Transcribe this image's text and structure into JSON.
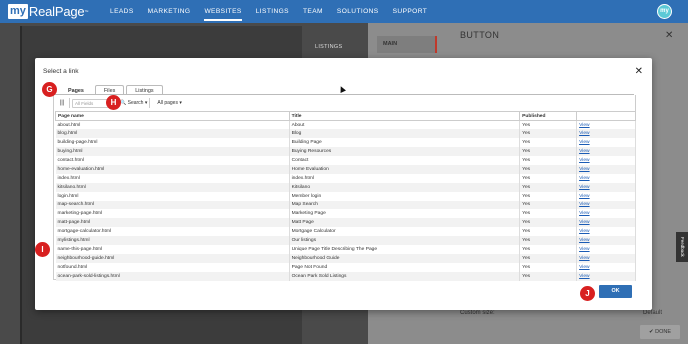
{
  "logo": {
    "my": "my",
    "brand": "RealPage",
    "tm": "™"
  },
  "nav": [
    "LEADS",
    "MARKETING",
    "WEBSITES",
    "LISTINGS",
    "TEAM",
    "SOLUTIONS",
    "SUPPORT"
  ],
  "nav_active": "WEBSITES",
  "user": {
    "initials": "my"
  },
  "background": {
    "listings_label": "LISTINGS",
    "main_tab": "MAIN",
    "panel_title": "BUTTON",
    "close": "✕",
    "feedback": "Feedback",
    "custom_size_label": "Custom size:",
    "custom_size_value": "Default",
    "done_label": "✔ DONE"
  },
  "modal": {
    "title": "Select a link",
    "close": "✕",
    "tabs": [
      "Pages",
      "Files",
      "Listings"
    ],
    "active_tab": "Pages",
    "toolbar": {
      "columns_icon": "|||",
      "filter_placeholder": "All Fields",
      "search_label": "Search ▾",
      "scope_label": "All pages ▾"
    },
    "table": {
      "headers": [
        "Page name",
        "Title",
        "Published",
        ""
      ],
      "rows": [
        [
          "about.html",
          "About",
          "Yes",
          "View"
        ],
        [
          "blog.html",
          "Blog",
          "Yes",
          "View"
        ],
        [
          "building-page.html",
          "Building Page",
          "Yes",
          "View"
        ],
        [
          "buying.html",
          "Buying Resources",
          "Yes",
          "View"
        ],
        [
          "contact.html",
          "Contact",
          "Yes",
          "View"
        ],
        [
          "home-evaluation.html",
          "Home Evaluation",
          "Yes",
          "View"
        ],
        [
          "index.html",
          "index.html",
          "Yes",
          "View"
        ],
        [
          "kitsilano.html",
          "Kitsilano",
          "Yes",
          "View"
        ],
        [
          "login.html",
          "Member login",
          "Yes",
          "View"
        ],
        [
          "map-search.html",
          "Map Search",
          "Yes",
          "View"
        ],
        [
          "marketing-page.html",
          "Marketing Page",
          "Yes",
          "View"
        ],
        [
          "matt-page.html",
          "Matt Page",
          "Yes",
          "View"
        ],
        [
          "mortgage-calculator.html",
          "Mortgage Calculator",
          "Yes",
          "View"
        ],
        [
          "mylistings.html",
          "Our listings",
          "Yes",
          "View"
        ],
        [
          "name-this-page.html",
          "Unique Page Title Describing The Page",
          "Yes",
          "View"
        ],
        [
          "neighbourhood-guide.html",
          "Neighbourhood Guide",
          "Yes",
          "View"
        ],
        [
          "notfound.html",
          "Page Not Found",
          "Yes",
          "View"
        ],
        [
          "ocean-park-sold-listings.html",
          "Ocean Park Sold Listings",
          "Yes",
          "View"
        ]
      ]
    },
    "ok_label": "OK"
  },
  "markers": [
    "G",
    "H",
    "I",
    "J"
  ]
}
